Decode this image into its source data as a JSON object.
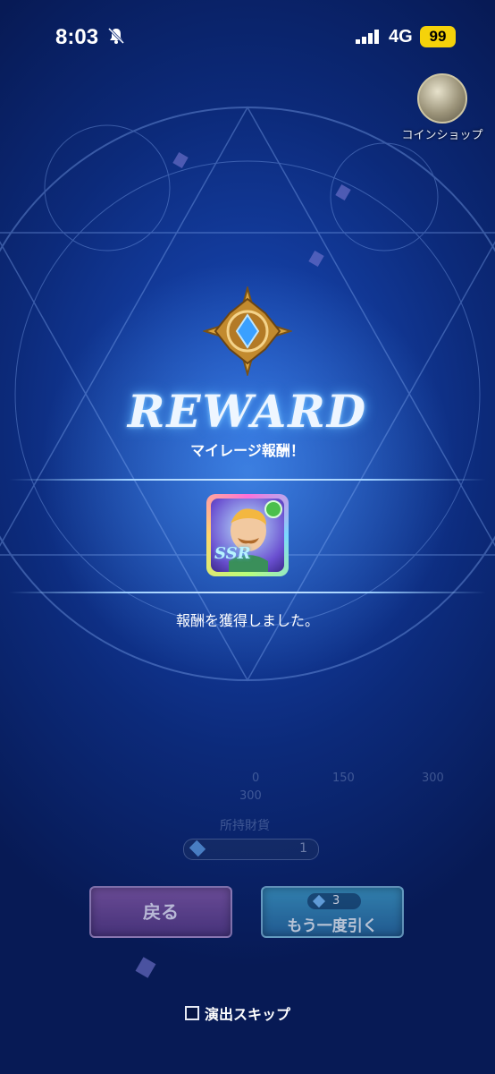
{
  "status_bar": {
    "time": "8:03",
    "network": "4G",
    "battery": "99"
  },
  "coin_shop": {
    "label": "コインショップ"
  },
  "reward": {
    "title": "REWARD",
    "subtitle": "マイレージ報酬！",
    "card_rarity": "SSR",
    "acquired_message": "報酬を獲得しました。"
  },
  "background_faded": {
    "row_values": [
      "0",
      "150",
      "300"
    ],
    "sub_value": "300",
    "currency_label": "所持財貨",
    "currency_value": "1"
  },
  "buttons": {
    "back_label": "戻る",
    "draw_again_cost": "3",
    "draw_again_label": "もう一度引く"
  },
  "skip": {
    "label": "演出スキップ",
    "checked": false
  },
  "colors": {
    "background": "#0c2a7a",
    "accent_glow": "#5ab0ff",
    "back_button": "#6e479a",
    "draw_again_button": "#3489b8"
  }
}
